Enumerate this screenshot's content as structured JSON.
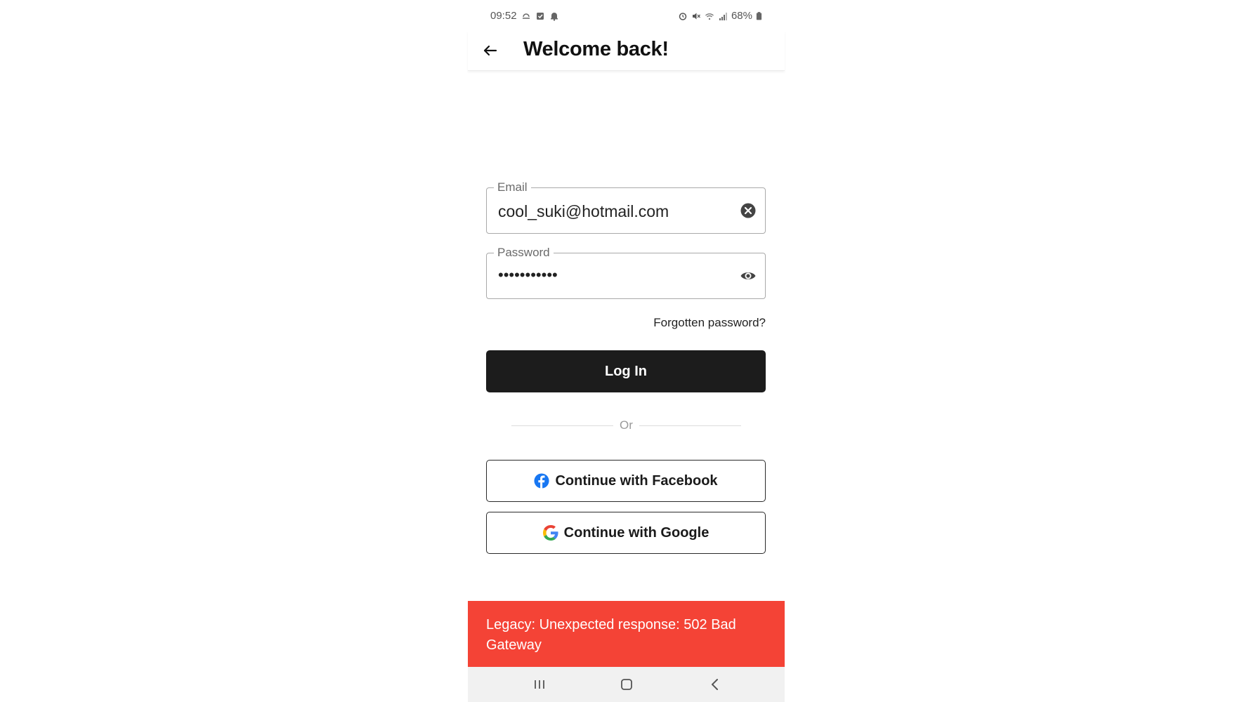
{
  "status_bar": {
    "time": "09:52",
    "battery": "68%"
  },
  "header": {
    "title": "Welcome back!"
  },
  "form": {
    "email_label": "Email",
    "email_value": "cool_suki@hotmail.com",
    "password_label": "Password",
    "password_masked": "•••••••••••",
    "forgot_link": "Forgotten password?",
    "login_button": "Log In",
    "divider_text": "Or"
  },
  "social": {
    "facebook_label": "Continue with Facebook",
    "google_label": "Continue with Google"
  },
  "snackbar": {
    "message": "Legacy: Unexpected response: 502 Bad Gateway"
  },
  "colors": {
    "error": "#f44336",
    "primary_button": "#1c1c1c",
    "facebook": "#1877f2"
  }
}
